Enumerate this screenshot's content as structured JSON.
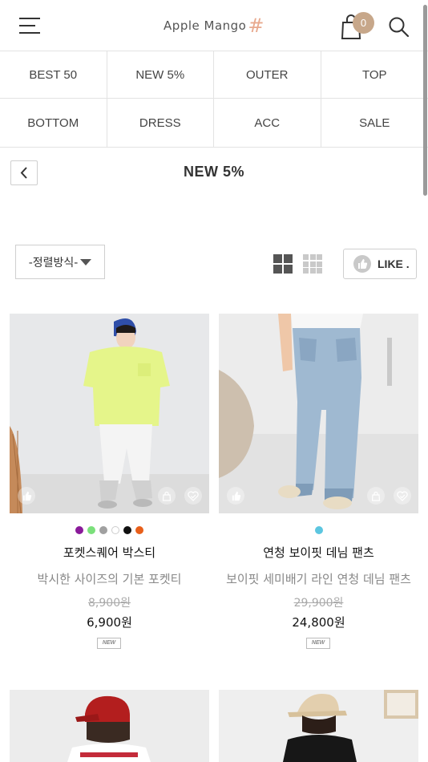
{
  "header": {
    "logo_text": "Apple Mango",
    "logo_mark": "#",
    "cart_count": "0",
    "icons": {
      "menu": "hamburger-menu-icon",
      "cart": "shopping-bag-icon",
      "search": "search-icon"
    }
  },
  "categories": [
    "BEST 50",
    "NEW 5%",
    "OUTER",
    "TOP",
    "BOTTOM",
    "DRESS",
    "ACC",
    "SALE"
  ],
  "page": {
    "title": "NEW 5%",
    "back_icon": "chevron-left-icon"
  },
  "toolbar": {
    "sort_label": "-정렬방식-",
    "like_label": "LIKE .",
    "view_icons": [
      "grid-2-icon",
      "grid-3-icon"
    ]
  },
  "products": [
    {
      "name": "포켓스퀘어 박스티",
      "desc": "박시한 사이즈의 기본 포켓티",
      "old_price": "8,900원",
      "price": "6,900원",
      "badge": "NEW",
      "colors": [
        "#8a1a9a",
        "#7be07b",
        "#a0a0a0",
        "#ffffff",
        "#111111",
        "#e85f1a"
      ]
    },
    {
      "name": "연청 보이핏 데님 팬츠",
      "desc": "보이핏 세미배기 라인 연청 데님 팬츠",
      "old_price": "29,900원",
      "price": "24,800원",
      "badge": "NEW",
      "colors": [
        "#5cc6e0"
      ]
    }
  ],
  "colors": {
    "accent": "#c7a78a",
    "border": "#e3e3e3",
    "logo_mark": "#e8a98e"
  }
}
